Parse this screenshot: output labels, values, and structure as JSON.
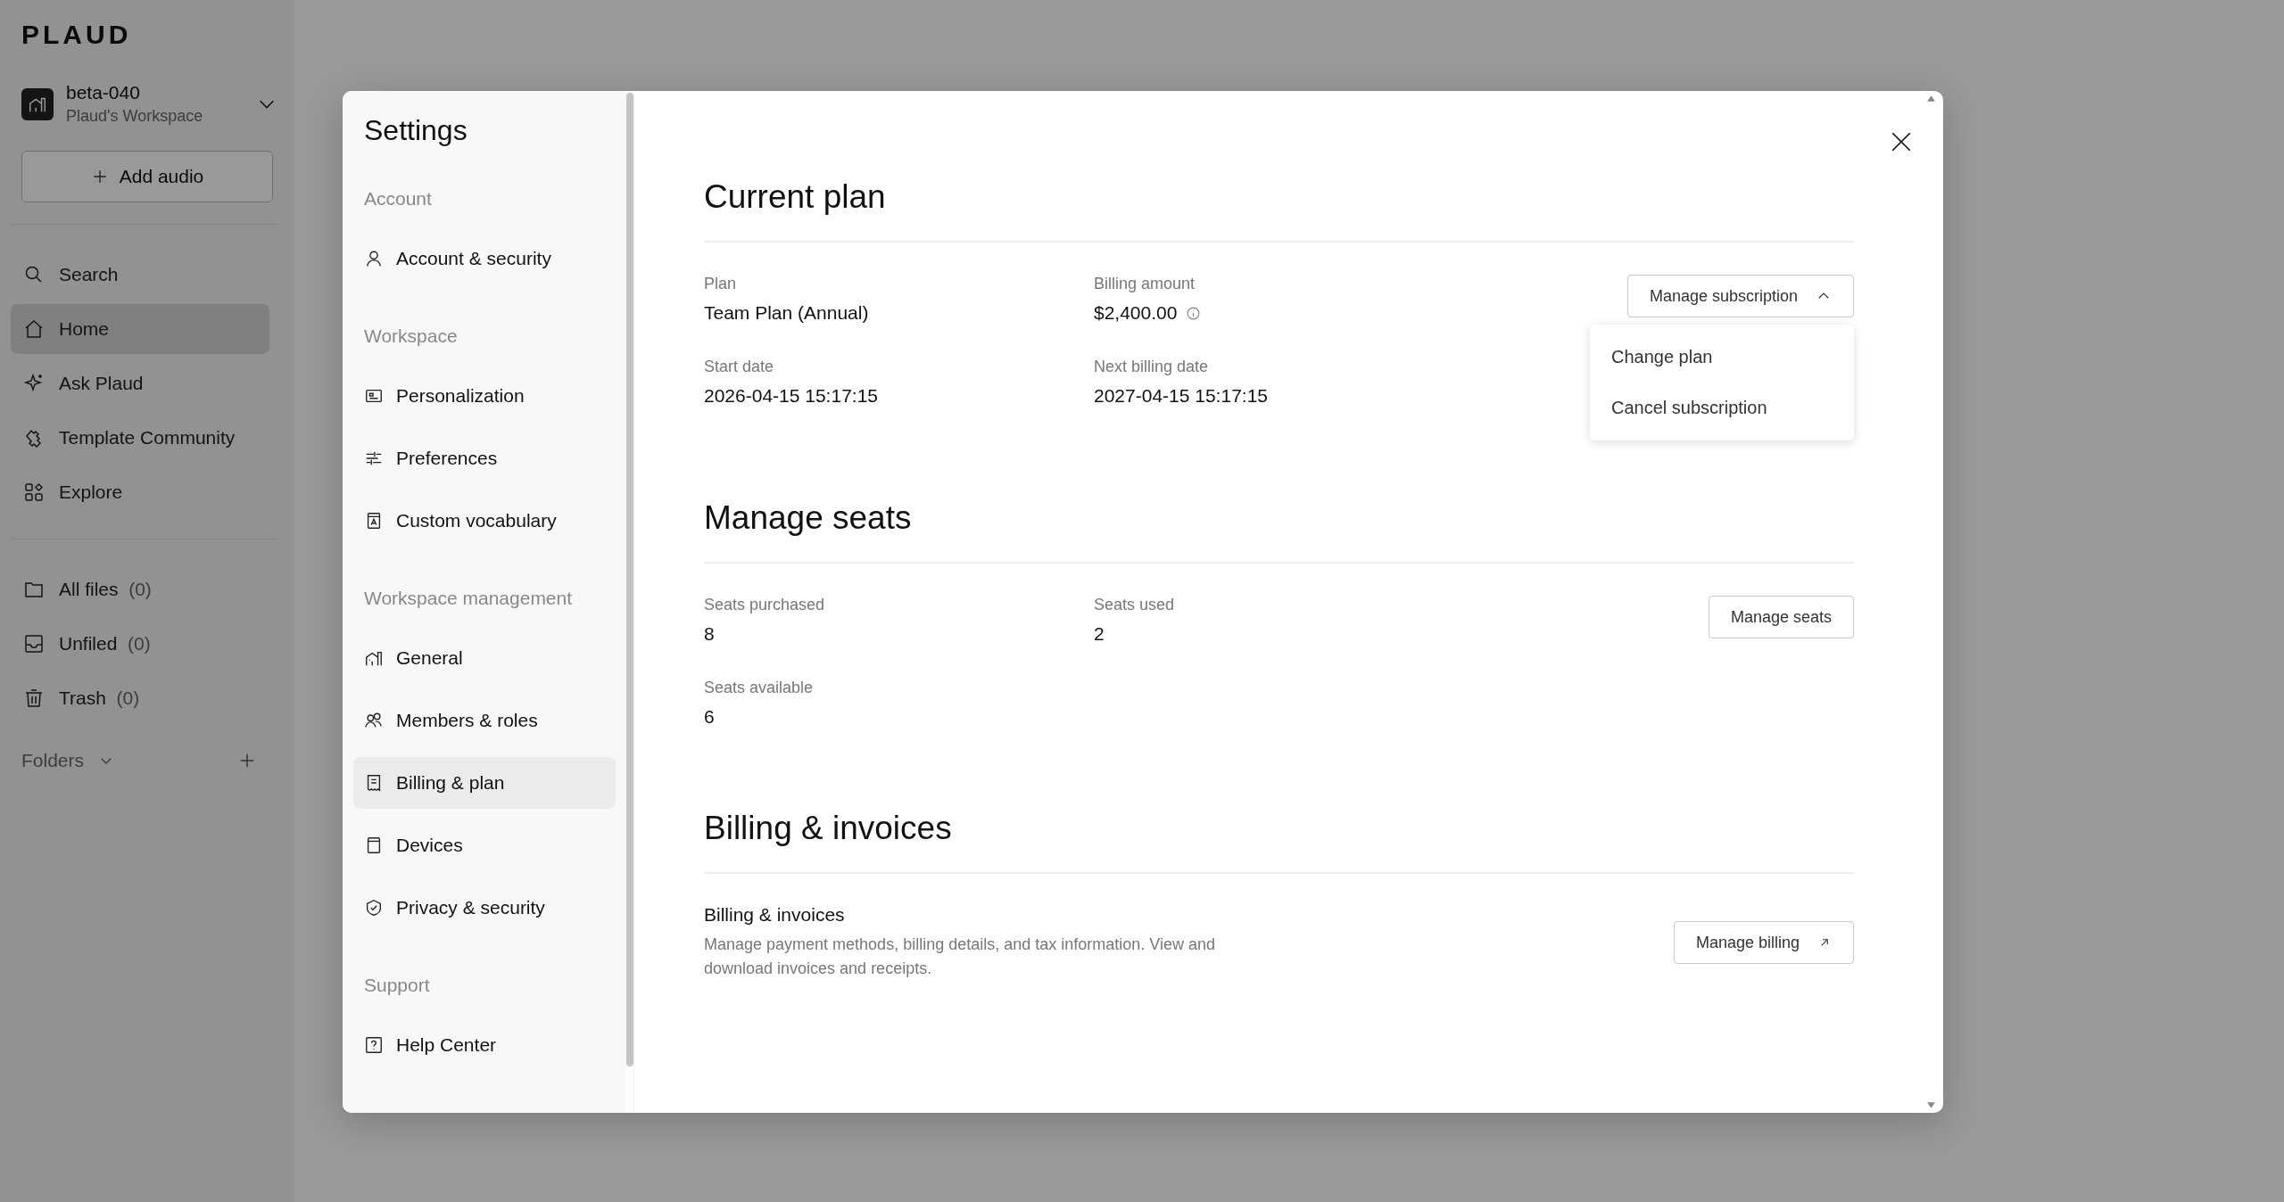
{
  "app": {
    "logo": "PLAUD",
    "workspace": {
      "name": "beta-040",
      "subtitle": "Plaud's Workspace"
    },
    "add_audio": "Add audio",
    "nav": [
      {
        "label": "Search",
        "selected": false
      },
      {
        "label": "Home",
        "selected": true
      },
      {
        "label": "Ask Plaud",
        "selected": false
      },
      {
        "label": "Template Community",
        "selected": false
      },
      {
        "label": "Explore",
        "selected": false
      }
    ],
    "files": [
      {
        "label": "All files",
        "count": "(0)"
      },
      {
        "label": "Unfiled",
        "count": "(0)"
      },
      {
        "label": "Trash",
        "count": "(0)"
      }
    ],
    "folders": "Folders"
  },
  "settings": {
    "title": "Settings",
    "groups": [
      {
        "heading": "Account",
        "items": [
          {
            "label": "Account & security",
            "selected": false
          }
        ]
      },
      {
        "heading": "Workspace",
        "items": [
          {
            "label": "Personalization",
            "selected": false
          },
          {
            "label": "Preferences",
            "selected": false
          },
          {
            "label": "Custom vocabulary",
            "selected": false
          }
        ]
      },
      {
        "heading": "Workspace management",
        "items": [
          {
            "label": "General",
            "selected": false
          },
          {
            "label": "Members & roles",
            "selected": false
          },
          {
            "label": "Billing & plan",
            "selected": true
          },
          {
            "label": "Devices",
            "selected": false
          },
          {
            "label": "Privacy & security",
            "selected": false
          }
        ]
      },
      {
        "heading": "Support",
        "items": [
          {
            "label": "Help Center",
            "selected": false
          }
        ]
      }
    ],
    "current_plan": {
      "title": "Current plan",
      "fields": [
        {
          "label": "Plan",
          "value": "Team Plan (Annual)",
          "info": false
        },
        {
          "label": "Billing amount",
          "value": "$2,400.00",
          "info": true
        },
        {
          "label": "Start date",
          "value": "2026-04-15 15:17:15",
          "info": false
        },
        {
          "label": "Next billing date",
          "value": "2027-04-15 15:17:15",
          "info": false
        }
      ],
      "button": {
        "label": "Manage subscription",
        "expanded": true
      },
      "menu": [
        "Change plan",
        "Cancel subscription"
      ]
    },
    "manage_seats": {
      "title": "Manage seats",
      "fields": [
        {
          "label": "Seats purchased",
          "value": "8"
        },
        {
          "label": "Seats used",
          "value": "2"
        },
        {
          "label": "Seats available",
          "value": "6"
        }
      ],
      "button": "Manage seats"
    },
    "billing": {
      "title": "Billing & invoices",
      "subtitle": "Billing & invoices",
      "description": "Manage payment methods, billing details, and tax information. View and download invoices and receipts.",
      "button": "Manage billing"
    }
  }
}
